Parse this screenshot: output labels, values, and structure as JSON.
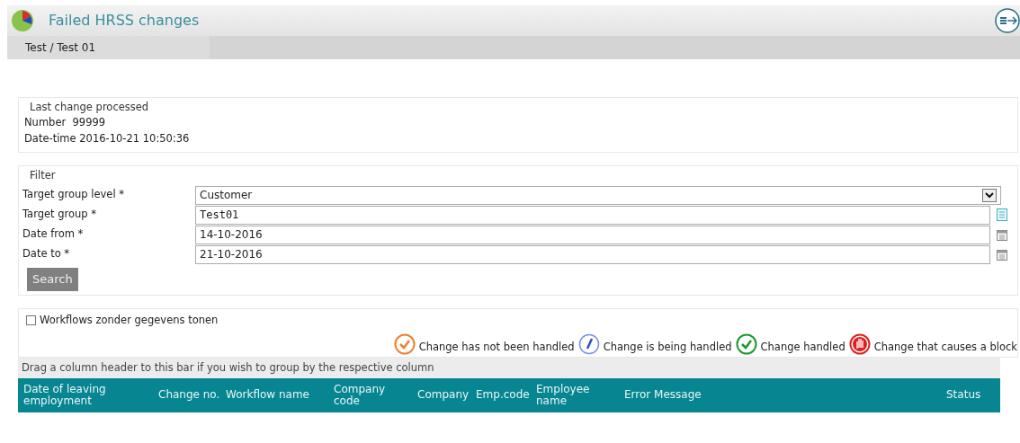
{
  "header": {
    "title": "Failed HRSS changes"
  },
  "breadcrumb": "Test / Test 01",
  "last_change": {
    "legend": "Last change processed",
    "lines": [
      "Number  99999",
      "Date-time 2016-10-21 10:50:36"
    ]
  },
  "filter": {
    "legend": "Filter",
    "fields": [
      {
        "label": "Target group level *",
        "value": "Customer",
        "kind": "select"
      },
      {
        "label": "Target group *",
        "value": "Test01",
        "kind": "lookup"
      },
      {
        "label": "Date from *",
        "value": "14-10-2016",
        "kind": "date"
      },
      {
        "label": "Date to *",
        "value": "21-10-2016",
        "kind": "date"
      }
    ],
    "button": "Search"
  },
  "options": {
    "checkbox": {
      "label": "Workflows zonder gegevens tonen",
      "checked": false
    }
  },
  "legend_items": [
    {
      "kind": "not_handled",
      "label": "Change has not been handled"
    },
    {
      "kind": "in_progress",
      "label": "Change is being handled"
    },
    {
      "kind": "handled",
      "label": "Change handled"
    },
    {
      "kind": "blocked",
      "label": "Change that causes a block"
    }
  ],
  "grid": {
    "group_bar": "Drag a column header to this bar if you wish to group by the respective column",
    "columns": [
      "Date of leaving employment",
      "Change no.",
      "Workflow name",
      "Company code",
      "Company",
      "Emp.code",
      "Employee name",
      "Error Message",
      "Status"
    ]
  }
}
